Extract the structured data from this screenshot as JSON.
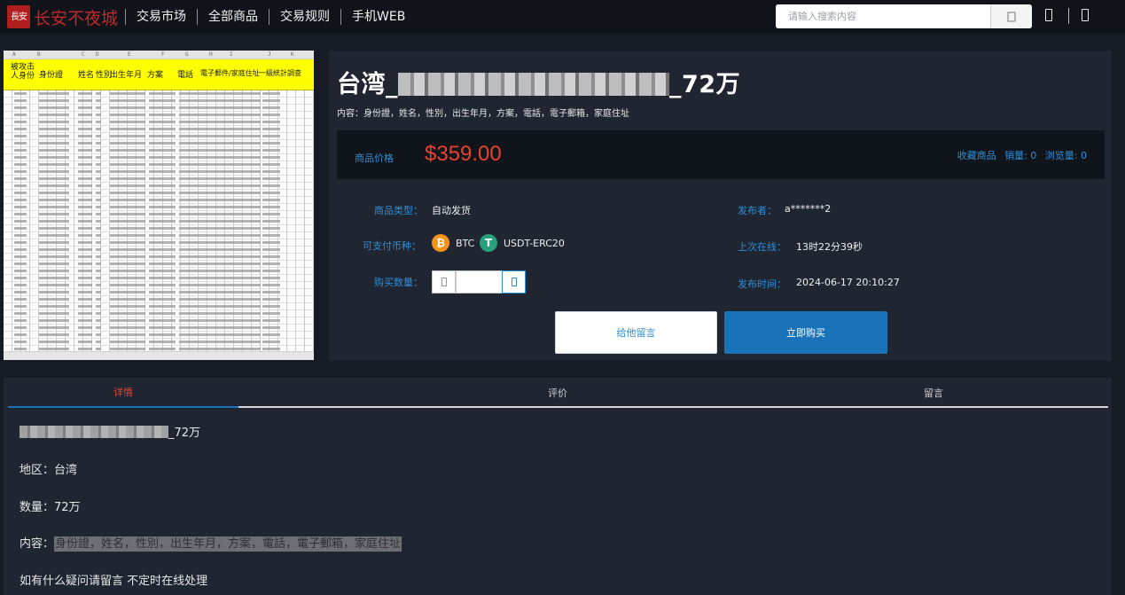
{
  "header": {
    "logo_seal": "長安",
    "logo_text": "长安不夜城",
    "nav": [
      "交易市场",
      "全部商品",
      "交易规则",
      "手机WEB"
    ],
    "search_placeholder": "请输入搜索内容",
    "search_button_icon": "search-icon"
  },
  "spreadsheet": {
    "headers": [
      "被攻击人身份",
      "身份證",
      "姓名",
      "性別",
      "出生年月",
      "方案",
      "電話",
      "電子郵件/家庭住址",
      "一級統計調查"
    ]
  },
  "product": {
    "title_prefix": "台湾_",
    "title_suffix": "_72万",
    "content": "内容：身份證，姓名，性別，出生年月，方案，電話，電子郵箱，家庭住址",
    "price_label": "商品价格",
    "price": "$359.00",
    "stats": {
      "favorite": "收藏商品",
      "sales": "销量: 0",
      "views": "浏览量: 0"
    },
    "type_label": "商品类型：",
    "type_value": "自动发货",
    "currency_label": "可支付币种：",
    "currencies": [
      {
        "name": "BTC",
        "symbol": "₿",
        "color": "#f7931a"
      },
      {
        "name": "USDT-ERC20",
        "symbol": "T",
        "color": "#26a17b"
      }
    ],
    "qty_label": "购买数量：",
    "qty_value": "",
    "publisher_label": "发布者：",
    "publisher_value": "a*******2",
    "last_online_label": "上次在线：",
    "last_online_value": "13时22分39秒",
    "publish_time_label": "发布时间：",
    "publish_time_value": "2024-06-17 20:10:27",
    "btn_message": "给他留言",
    "btn_buy": "立即购买"
  },
  "tabs": [
    "详情",
    "评价",
    "留言"
  ],
  "detail": {
    "line1_suffix": "_72万",
    "region": "地区：台湾",
    "count": "数量：72万",
    "content_label": "内容：",
    "content_value": "身份證，姓名，性別，出生年月，方案，電話，電子郵箱，家庭住址",
    "note": "如有什么疑问请留言 不定时在线处理"
  }
}
